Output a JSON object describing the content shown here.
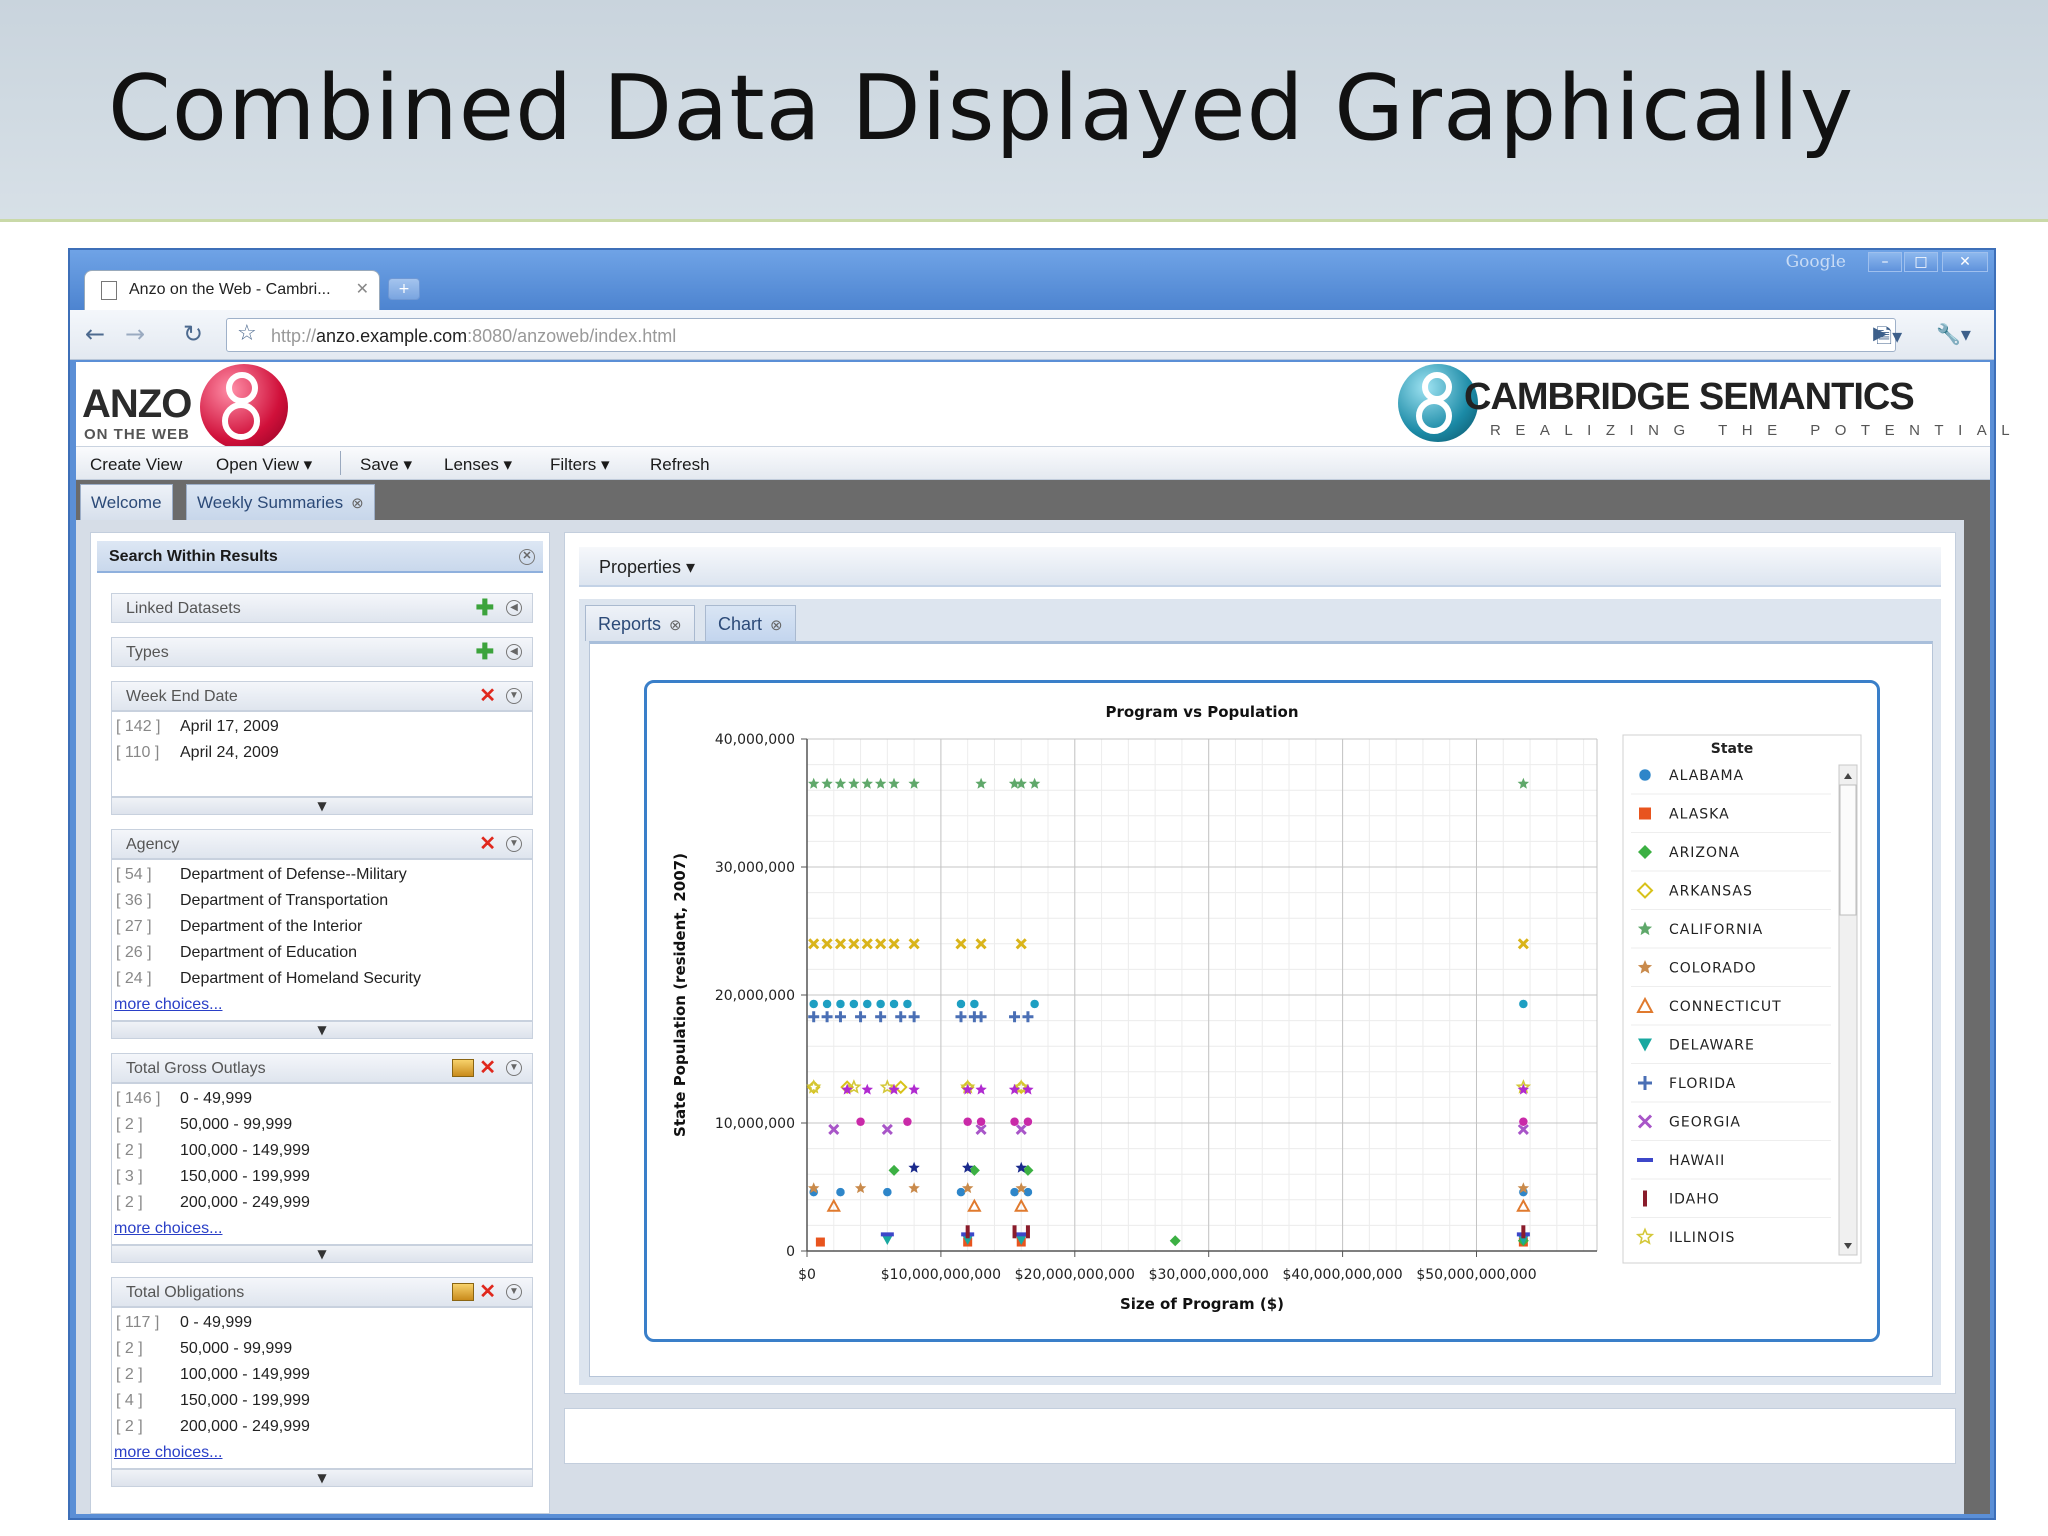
{
  "slide": {
    "title": "Combined Data Displayed Graphically"
  },
  "browser": {
    "search_label": "Google",
    "tab_title": "Anzo on the Web - Cambri...",
    "url_prefix": "http://",
    "url_host": "anzo.example.com",
    "url_rest": ":8080/anzoweb/index.html"
  },
  "app": {
    "logo_text": "ANZO",
    "logo_sub": "ON THE WEB",
    "company_name": "CAMBRIDGE SEMANTICS",
    "company_tagline": "REALIZING THE POTENTIAL",
    "menu": [
      "Create View",
      "Open View",
      "Save",
      "Lenses",
      "Filters",
      "Refresh"
    ],
    "tabs": [
      "Welcome",
      "Weekly Summaries"
    ]
  },
  "left_panel": {
    "search_header": "Search Within Results",
    "linked_datasets": "Linked Datasets",
    "types": "Types",
    "week_end_date": {
      "title": "Week End Date",
      "rows": [
        {
          "count": "[ 142 ]",
          "label": "April 17, 2009"
        },
        {
          "count": "[ 110 ]",
          "label": "April 24, 2009"
        }
      ]
    },
    "agency": {
      "title": "Agency",
      "rows": [
        {
          "count": "[ 54 ]",
          "label": "Department of Defense--Military"
        },
        {
          "count": "[ 36 ]",
          "label": "Department of Transportation"
        },
        {
          "count": "[ 27 ]",
          "label": "Department of the Interior"
        },
        {
          "count": "[ 26 ]",
          "label": "Department of Education"
        },
        {
          "count": "[ 24 ]",
          "label": "Department of Homeland Security"
        }
      ],
      "more": "more choices..."
    },
    "total_gross_outlays": {
      "title": "Total Gross Outlays",
      "rows": [
        {
          "count": "[ 146 ]",
          "label": "0 - 49,999"
        },
        {
          "count": "[ 2 ]",
          "label": "50,000 - 99,999"
        },
        {
          "count": "[ 2 ]",
          "label": "100,000 - 149,999"
        },
        {
          "count": "[ 3 ]",
          "label": "150,000 - 199,999"
        },
        {
          "count": "[ 2 ]",
          "label": "200,000 - 249,999"
        }
      ],
      "more": "more choices..."
    },
    "total_obligations": {
      "title": "Total Obligations",
      "rows": [
        {
          "count": "[ 117 ]",
          "label": "0 - 49,999"
        },
        {
          "count": "[ 2 ]",
          "label": "50,000 - 99,999"
        },
        {
          "count": "[ 2 ]",
          "label": "100,000 - 149,999"
        },
        {
          "count": "[ 4 ]",
          "label": "150,000 - 199,999"
        },
        {
          "count": "[ 2 ]",
          "label": "200,000 - 249,999"
        }
      ],
      "more": "more choices..."
    }
  },
  "right_panel": {
    "properties": "Properties",
    "tabs": [
      "Reports",
      "Chart"
    ]
  },
  "chart_data": {
    "type": "scatter",
    "title": "Program vs Population",
    "xlabel": "Size of Program ($)",
    "ylabel": "State Population (resident, 2007)",
    "xlim": [
      0,
      59000000000
    ],
    "ylim": [
      0,
      40000000
    ],
    "x_ticks": [
      0,
      10000000000,
      20000000000,
      30000000000,
      40000000000,
      50000000000
    ],
    "x_tick_labels": [
      "$0",
      "$10,000,000,000",
      "$20,000,000,000",
      "$30,000,000,000",
      "$40,000,000,000",
      "$50,000,000,000"
    ],
    "y_ticks": [
      0,
      10000000,
      20000000,
      30000000,
      40000000
    ],
    "y_tick_labels": [
      "0",
      "10,000,000",
      "20,000,000",
      "30,000,000",
      "40,000,000"
    ],
    "grid": true,
    "legend_title": "State",
    "legend_position": "right",
    "series": [
      {
        "name": "ALABAMA",
        "color": "#2e86c9",
        "marker": "circle",
        "x": [
          500000000,
          2500000000,
          6000000000,
          11500000000,
          15500000000,
          16500000000,
          53500000000
        ],
        "y": [
          4600000,
          4600000,
          4600000,
          4600000,
          4600000,
          4600000,
          4600000
        ]
      },
      {
        "name": "ALASKA",
        "color": "#e8541e",
        "marker": "square",
        "x": [
          1000000000,
          12000000000,
          16000000000,
          53500000000
        ],
        "y": [
          700000,
          700000,
          700000,
          700000
        ]
      },
      {
        "name": "ARIZONA",
        "color": "#3cb043",
        "marker": "diamond",
        "x": [
          6500000000,
          12500000000,
          16500000000,
          27500000000,
          53500000000
        ],
        "y": [
          6300000,
          6300000,
          6300000,
          800000,
          800000
        ]
      },
      {
        "name": "ARKANSAS",
        "color": "#d8c21a",
        "marker": "diamond-outline",
        "x": [
          500000000,
          3000000000,
          7000000000,
          12000000000,
          16000000000
        ],
        "y": [
          12800000,
          12800000,
          12800000,
          12800000,
          12800000
        ]
      },
      {
        "name": "CALIFORNIA",
        "color": "#5fa86a",
        "marker": "star",
        "x": [
          500000000,
          1500000000,
          2500000000,
          3500000000,
          4500000000,
          5500000000,
          6500000000,
          8000000000,
          13000000000,
          15500000000,
          16000000000,
          17000000000,
          53500000000
        ],
        "y": [
          36500000,
          36500000,
          36500000,
          36500000,
          36500000,
          36500000,
          36500000,
          36500000,
          36500000,
          36500000,
          36500000,
          36500000,
          36500000
        ]
      },
      {
        "name": "COLORADO",
        "color": "#c98a4b",
        "marker": "star",
        "x": [
          500000000,
          4000000000,
          8000000000,
          12000000000,
          16000000000,
          53500000000
        ],
        "y": [
          4900000,
          4900000,
          4900000,
          4900000,
          4900000,
          4900000
        ]
      },
      {
        "name": "CONNECTICUT",
        "color": "#e07a2e",
        "marker": "triangle-outline",
        "x": [
          2000000000,
          12500000000,
          16000000000,
          53500000000
        ],
        "y": [
          3500000,
          3500000,
          3500000,
          3500000
        ]
      },
      {
        "name": "DELAWARE",
        "color": "#19a8a0",
        "marker": "triangle-down",
        "x": [
          6000000000,
          12000000000,
          16000000000,
          53500000000
        ],
        "y": [
          900000,
          900000,
          900000,
          900000
        ]
      },
      {
        "name": "FLORIDA",
        "color": "#4a6fb5",
        "marker": "plus",
        "x": [
          500000000,
          1500000000,
          2500000000,
          4000000000,
          5500000000,
          7000000000,
          8000000000,
          11500000000,
          12500000000,
          13000000000,
          15500000000,
          16500000000
        ],
        "y": [
          18300000,
          18300000,
          18300000,
          18300000,
          18300000,
          18300000,
          18300000,
          18300000,
          18300000,
          18300000,
          18300000,
          18300000
        ]
      },
      {
        "name": "GEORGIA",
        "color": "#a855c8",
        "marker": "x",
        "x": [
          2000000000,
          6000000000,
          13000000000,
          16000000000,
          53500000000
        ],
        "y": [
          9500000,
          9500000,
          9500000,
          9500000,
          9500000
        ]
      },
      {
        "name": "HAWAII",
        "color": "#3d47c9",
        "marker": "dash",
        "x": [
          6000000000,
          12000000000,
          16000000000,
          53500000000
        ],
        "y": [
          1300000,
          1300000,
          1300000,
          1300000
        ]
      },
      {
        "name": "IDAHO",
        "color": "#8a1c2b",
        "marker": "bar",
        "x": [
          12000000000,
          15500000000,
          16500000000,
          53500000000
        ],
        "y": [
          1500000,
          1500000,
          1500000,
          1500000
        ]
      },
      {
        "name": "ILLINOIS",
        "color": "#d4c83a",
        "marker": "star-outline",
        "x": [
          500000000,
          3500000000,
          6000000000,
          12000000000,
          16000000000,
          53500000000
        ],
        "y": [
          12800000,
          12800000,
          12800000,
          12800000,
          12800000,
          12800000
        ]
      },
      {
        "name": "",
        "color": "#1e9fc2",
        "marker": "circle",
        "x": [
          500000000,
          1500000000,
          2500000000,
          3500000000,
          4500000000,
          5500000000,
          6500000000,
          7500000000,
          11500000000,
          12500000000,
          17000000000,
          53500000000
        ],
        "y": [
          19300000,
          19300000,
          19300000,
          19300000,
          19300000,
          19300000,
          19300000,
          19300000,
          19300000,
          19300000,
          19300000,
          19300000
        ]
      },
      {
        "name": "",
        "color": "#d9b41a",
        "marker": "x",
        "x": [
          500000000,
          1500000000,
          2500000000,
          3500000000,
          4500000000,
          5500000000,
          6500000000,
          8000000000,
          11500000000,
          13000000000,
          16000000000,
          53500000000
        ],
        "y": [
          24000000,
          24000000,
          24000000,
          24000000,
          24000000,
          24000000,
          24000000,
          24000000,
          24000000,
          24000000,
          24000000,
          24000000
        ]
      },
      {
        "name": "",
        "color": "#b02ad0",
        "marker": "star",
        "x": [
          3000000000,
          4500000000,
          6500000000,
          8000000000,
          12000000000,
          13000000000,
          15500000000,
          16500000000,
          53500000000
        ],
        "y": [
          12600000,
          12600000,
          12600000,
          12600000,
          12600000,
          12600000,
          12600000,
          12600000,
          12600000
        ]
      },
      {
        "name": "",
        "color": "#c92aa8",
        "marker": "circle",
        "x": [
          4000000000,
          7500000000,
          12000000000,
          13000000000,
          15500000000,
          16500000000,
          53500000000
        ],
        "y": [
          10100000,
          10100000,
          10100000,
          10100000,
          10100000,
          10100000,
          10100000
        ]
      },
      {
        "name": "",
        "color": "#1a2a8c",
        "marker": "star",
        "x": [
          8000000000,
          12000000000,
          16000000000
        ],
        "y": [
          6500000,
          6500000,
          6500000
        ]
      }
    ]
  }
}
